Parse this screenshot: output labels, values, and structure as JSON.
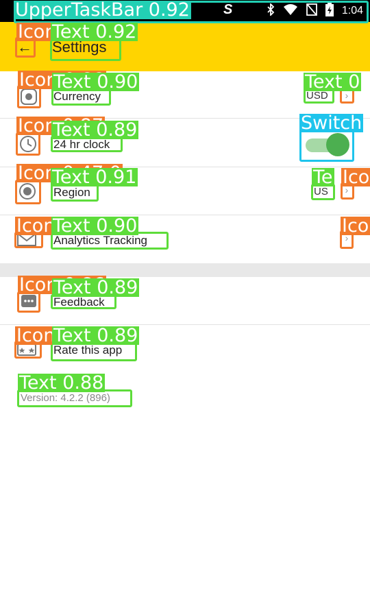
{
  "status_bar": {
    "app_indicator": "S",
    "time": "1:04",
    "icons": [
      "bluetooth-icon",
      "wifi-icon",
      "no-sim-icon",
      "battery-icon"
    ]
  },
  "toolbar": {
    "back_glyph": "←",
    "title": "Settings"
  },
  "settings": {
    "currency": {
      "label": "Currency",
      "value": "USD"
    },
    "clock": {
      "label": "24 hr clock",
      "enabled": true
    },
    "region": {
      "label": "Region",
      "value": "US"
    },
    "analytics": {
      "label": "Analytics Tracking"
    },
    "feedback": {
      "label": "Feedback"
    },
    "rate": {
      "label": "Rate this app"
    },
    "version": "Version: 4.2.2 (896)"
  },
  "detections": {
    "upper_task_bar": "UpperTaskBar 0.92",
    "title_icon": "Icon",
    "title_text": "Text 0.92",
    "currency_icon": "Icon 0.88",
    "currency_text": "Text 0.90",
    "currency_value": "Text 0",
    "clock_icon": "Icon 0.87",
    "clock_text": "Text 0.89",
    "clock_switch": "Switch",
    "region_icon": "Icon 0.47 0",
    "region_text": "Text 0.91",
    "region_value": "Te",
    "region_chevron": "Ico",
    "analytics_icon": "Icon",
    "analytics_text": "Text 0.90",
    "analytics_chevron": "Ico",
    "feedback_icon": "Icon 0.86",
    "feedback_text": "Text 0.89",
    "rate_icon": "Icon",
    "rate_text": "Text 0.89",
    "version_text": "Text 0.88"
  },
  "colors": {
    "toolbar": "#ffd400",
    "text_box": "#5ddc3a",
    "icon_box": "#f27a2b",
    "switch_box": "#1ec4ec",
    "bar_box": "#22d0b4"
  }
}
